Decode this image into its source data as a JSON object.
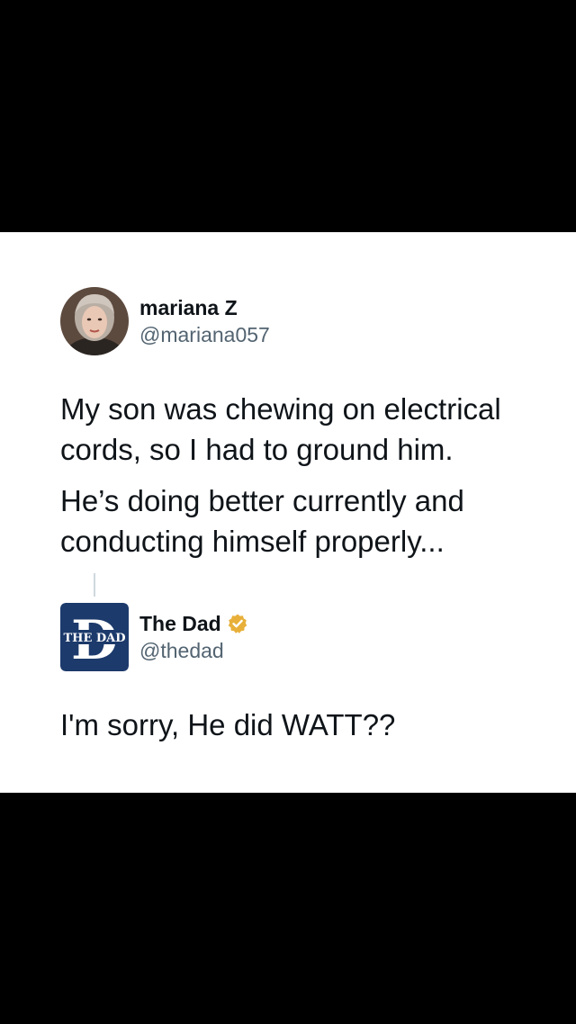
{
  "tweet1": {
    "display_name": "mariana Z",
    "handle": "@mariana057",
    "paragraph1": "My son was chewing on electrical cords, so I had to ground him.",
    "paragraph2": "He’s doing better currently and conducting himself properly..."
  },
  "tweet2": {
    "display_name": "The Dad",
    "handle": "@thedad",
    "logo_text": "THE DAD",
    "logo_letter": "D",
    "text": "I'm sorry, He did WATT??",
    "verified_icon": "verified-badge-icon"
  },
  "colors": {
    "brand_navy": "#1c3a6b",
    "verified_gold": "#e8b03a",
    "text": "#0f1419",
    "muted": "#536471"
  }
}
